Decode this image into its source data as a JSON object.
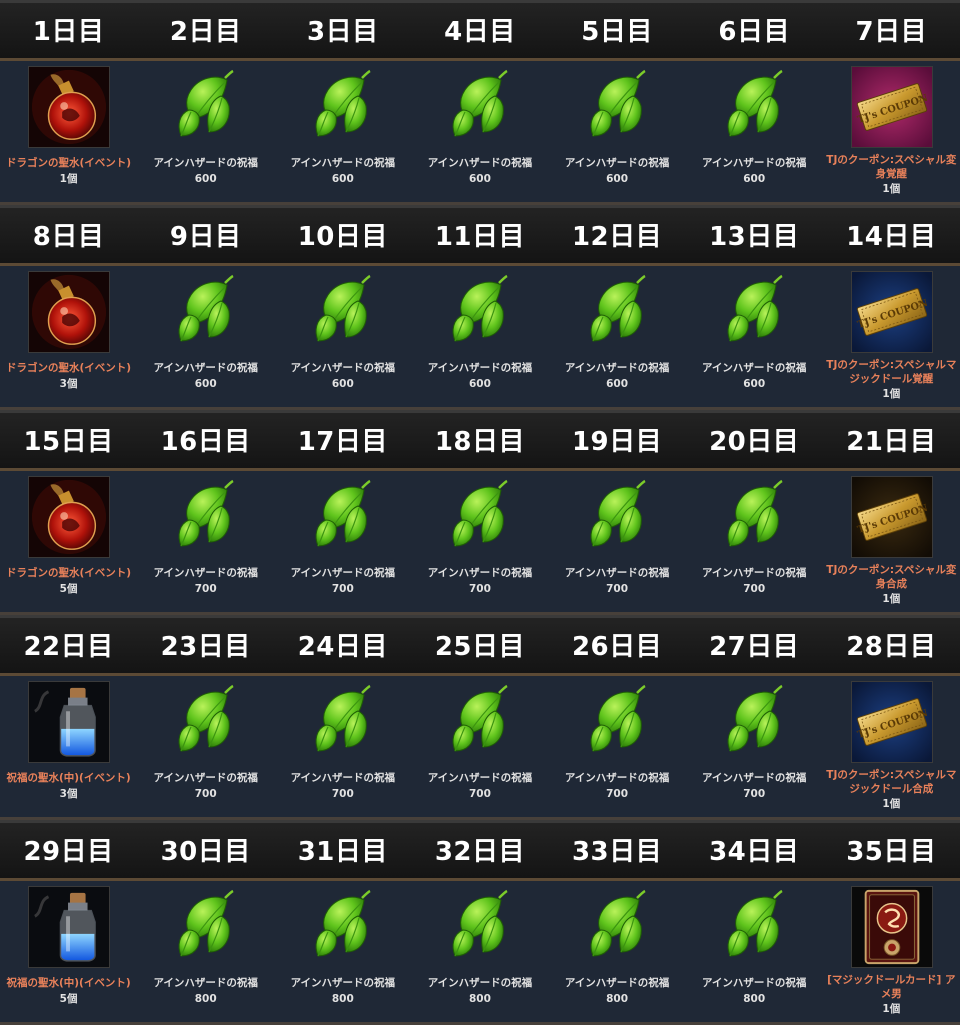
{
  "weeks": [
    {
      "days": [
        {
          "label": "1日目",
          "icon": "dragon-potion-icon",
          "name": "ドラゴンの聖水(イベント)",
          "qty": "1個",
          "special": true
        },
        {
          "label": "2日目",
          "icon": "leaf-icon",
          "name": "アインハザードの祝福",
          "qty": "600",
          "special": false
        },
        {
          "label": "3日目",
          "icon": "leaf-icon",
          "name": "アインハザードの祝福",
          "qty": "600",
          "special": false
        },
        {
          "label": "4日目",
          "icon": "leaf-icon",
          "name": "アインハザードの祝福",
          "qty": "600",
          "special": false
        },
        {
          "label": "5日目",
          "icon": "leaf-icon",
          "name": "アインハザードの祝福",
          "qty": "600",
          "special": false
        },
        {
          "label": "6日目",
          "icon": "leaf-icon",
          "name": "アインハザードの祝福",
          "qty": "600",
          "special": false
        },
        {
          "label": "7日目",
          "icon": "coupon-pink-icon",
          "name": "TJのクーポン:スペシャル変身覚醒",
          "qty": "1個",
          "special": true
        }
      ]
    },
    {
      "days": [
        {
          "label": "8日目",
          "icon": "dragon-potion-icon",
          "name": "ドラゴンの聖水(イベント)",
          "qty": "3個",
          "special": true
        },
        {
          "label": "9日目",
          "icon": "leaf-icon",
          "name": "アインハザードの祝福",
          "qty": "600",
          "special": false
        },
        {
          "label": "10日目",
          "icon": "leaf-icon",
          "name": "アインハザードの祝福",
          "qty": "600",
          "special": false
        },
        {
          "label": "11日目",
          "icon": "leaf-icon",
          "name": "アインハザードの祝福",
          "qty": "600",
          "special": false
        },
        {
          "label": "12日目",
          "icon": "leaf-icon",
          "name": "アインハザードの祝福",
          "qty": "600",
          "special": false
        },
        {
          "label": "13日目",
          "icon": "leaf-icon",
          "name": "アインハザードの祝福",
          "qty": "600",
          "special": false
        },
        {
          "label": "14日目",
          "icon": "coupon-blue-icon",
          "name": "TJのクーポン:スペシャルマジックドール覚醒",
          "qty": "1個",
          "special": true
        }
      ]
    },
    {
      "days": [
        {
          "label": "15日目",
          "icon": "dragon-potion-icon",
          "name": "ドラゴンの聖水(イベント)",
          "qty": "5個",
          "special": true
        },
        {
          "label": "16日目",
          "icon": "leaf-icon",
          "name": "アインハザードの祝福",
          "qty": "700",
          "special": false
        },
        {
          "label": "17日目",
          "icon": "leaf-icon",
          "name": "アインハザードの祝福",
          "qty": "700",
          "special": false
        },
        {
          "label": "18日目",
          "icon": "leaf-icon",
          "name": "アインハザードの祝福",
          "qty": "700",
          "special": false
        },
        {
          "label": "19日目",
          "icon": "leaf-icon",
          "name": "アインハザードの祝福",
          "qty": "700",
          "special": false
        },
        {
          "label": "20日目",
          "icon": "leaf-icon",
          "name": "アインハザードの祝福",
          "qty": "700",
          "special": false
        },
        {
          "label": "21日目",
          "icon": "coupon-dark-icon",
          "name": "TJのクーポン:スペシャル変身合成",
          "qty": "1個",
          "special": true
        }
      ]
    },
    {
      "days": [
        {
          "label": "22日目",
          "icon": "blue-potion-icon",
          "name": "祝福の聖水(中)(イベント)",
          "qty": "3個",
          "special": true
        },
        {
          "label": "23日目",
          "icon": "leaf-icon",
          "name": "アインハザードの祝福",
          "qty": "700",
          "special": false
        },
        {
          "label": "24日目",
          "icon": "leaf-icon",
          "name": "アインハザードの祝福",
          "qty": "700",
          "special": false
        },
        {
          "label": "25日目",
          "icon": "leaf-icon",
          "name": "アインハザードの祝福",
          "qty": "700",
          "special": false
        },
        {
          "label": "26日目",
          "icon": "leaf-icon",
          "name": "アインハザードの祝福",
          "qty": "700",
          "special": false
        },
        {
          "label": "27日目",
          "icon": "leaf-icon",
          "name": "アインハザードの祝福",
          "qty": "700",
          "special": false
        },
        {
          "label": "28日目",
          "icon": "coupon-blue-icon",
          "name": "TJのクーポン:スペシャルマジックドール合成",
          "qty": "1個",
          "special": true
        }
      ]
    },
    {
      "days": [
        {
          "label": "29日目",
          "icon": "blue-potion-icon",
          "name": "祝福の聖水(中)(イベント)",
          "qty": "5個",
          "special": true
        },
        {
          "label": "30日目",
          "icon": "leaf-icon",
          "name": "アインハザードの祝福",
          "qty": "800",
          "special": false
        },
        {
          "label": "31日目",
          "icon": "leaf-icon",
          "name": "アインハザードの祝福",
          "qty": "800",
          "special": false
        },
        {
          "label": "32日目",
          "icon": "leaf-icon",
          "name": "アインハザードの祝福",
          "qty": "800",
          "special": false
        },
        {
          "label": "33日目",
          "icon": "leaf-icon",
          "name": "アインハザードの祝福",
          "qty": "800",
          "special": false
        },
        {
          "label": "34日目",
          "icon": "leaf-icon",
          "name": "アインハザードの祝福",
          "qty": "800",
          "special": false
        },
        {
          "label": "35日目",
          "icon": "magic-doll-card-icon",
          "name": "[マジックドールカード] アメ男",
          "qty": "1個",
          "special": true
        }
      ]
    }
  ],
  "colors": {
    "header_bg": "#1a1a1a",
    "row_bg": "#1f2836",
    "special_text": "#e8815a",
    "normal_text": "#e2e2e2",
    "separator": "#5c4a35"
  }
}
